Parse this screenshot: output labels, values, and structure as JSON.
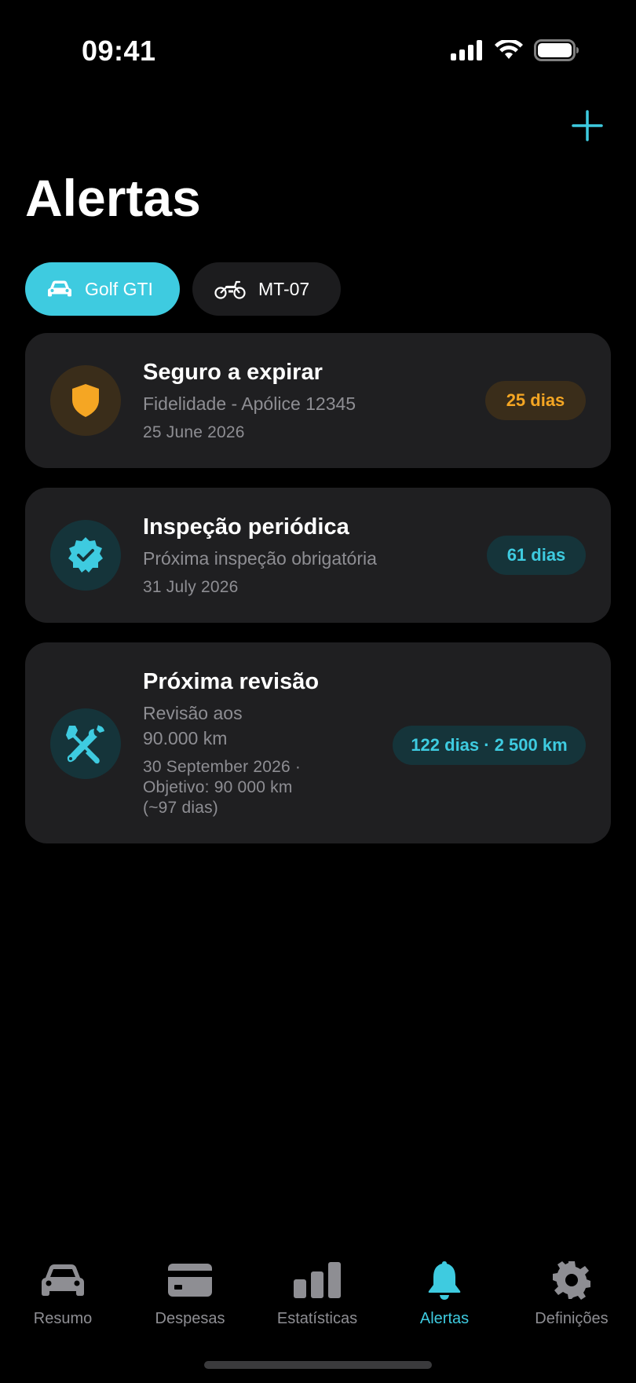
{
  "status_bar": {
    "time": "09:41",
    "icons": [
      "signal-icon",
      "wifi-icon",
      "battery-icon"
    ]
  },
  "header": {
    "title": "Alertas",
    "add_icon": "plus-icon"
  },
  "vehicles": [
    {
      "label": "Golf GTI",
      "icon": "car-icon",
      "selected": true
    },
    {
      "label": "MT-07",
      "icon": "motorcycle-icon",
      "selected": false
    }
  ],
  "alerts": [
    {
      "title": "Seguro a expirar",
      "subtitle": "Fidelidade - Apólice 12345",
      "date": "25 June 2026",
      "badge": "25 dias",
      "icon": "shield-icon",
      "accent": "#f5a623"
    },
    {
      "title": "Inspeção periódica",
      "subtitle": "Próxima inspeção obrigatória",
      "date": "31 July 2026",
      "badge": "61 dias",
      "icon": "verified-badge-icon",
      "accent": "#3ecbe0"
    },
    {
      "title": "Próxima revisão",
      "subtitle_line1": "Revisão aos",
      "subtitle_line2": "90.000 km",
      "date_line1": "30 September 2026 ·",
      "date_line2": "Objetivo: 90 000 km",
      "date_line3": "(~97 dias)",
      "badge": "122 dias · 2 500 km",
      "icon": "wrench-screwdriver-icon",
      "accent": "#3ecbe0"
    }
  ],
  "tabs": [
    {
      "label": "Resumo",
      "icon": "car-icon",
      "active": false
    },
    {
      "label": "Despesas",
      "icon": "credit-card-icon",
      "active": false
    },
    {
      "label": "Estatísticas",
      "icon": "bar-chart-icon",
      "active": false
    },
    {
      "label": "Alertas",
      "icon": "bell-icon",
      "active": true
    },
    {
      "label": "Definições",
      "icon": "gear-icon",
      "active": false
    }
  ],
  "colors": {
    "accent": "#3ecbe0",
    "warning": "#f5a623",
    "card_bg": "#1f1f21",
    "inactive": "#8e8e93"
  }
}
